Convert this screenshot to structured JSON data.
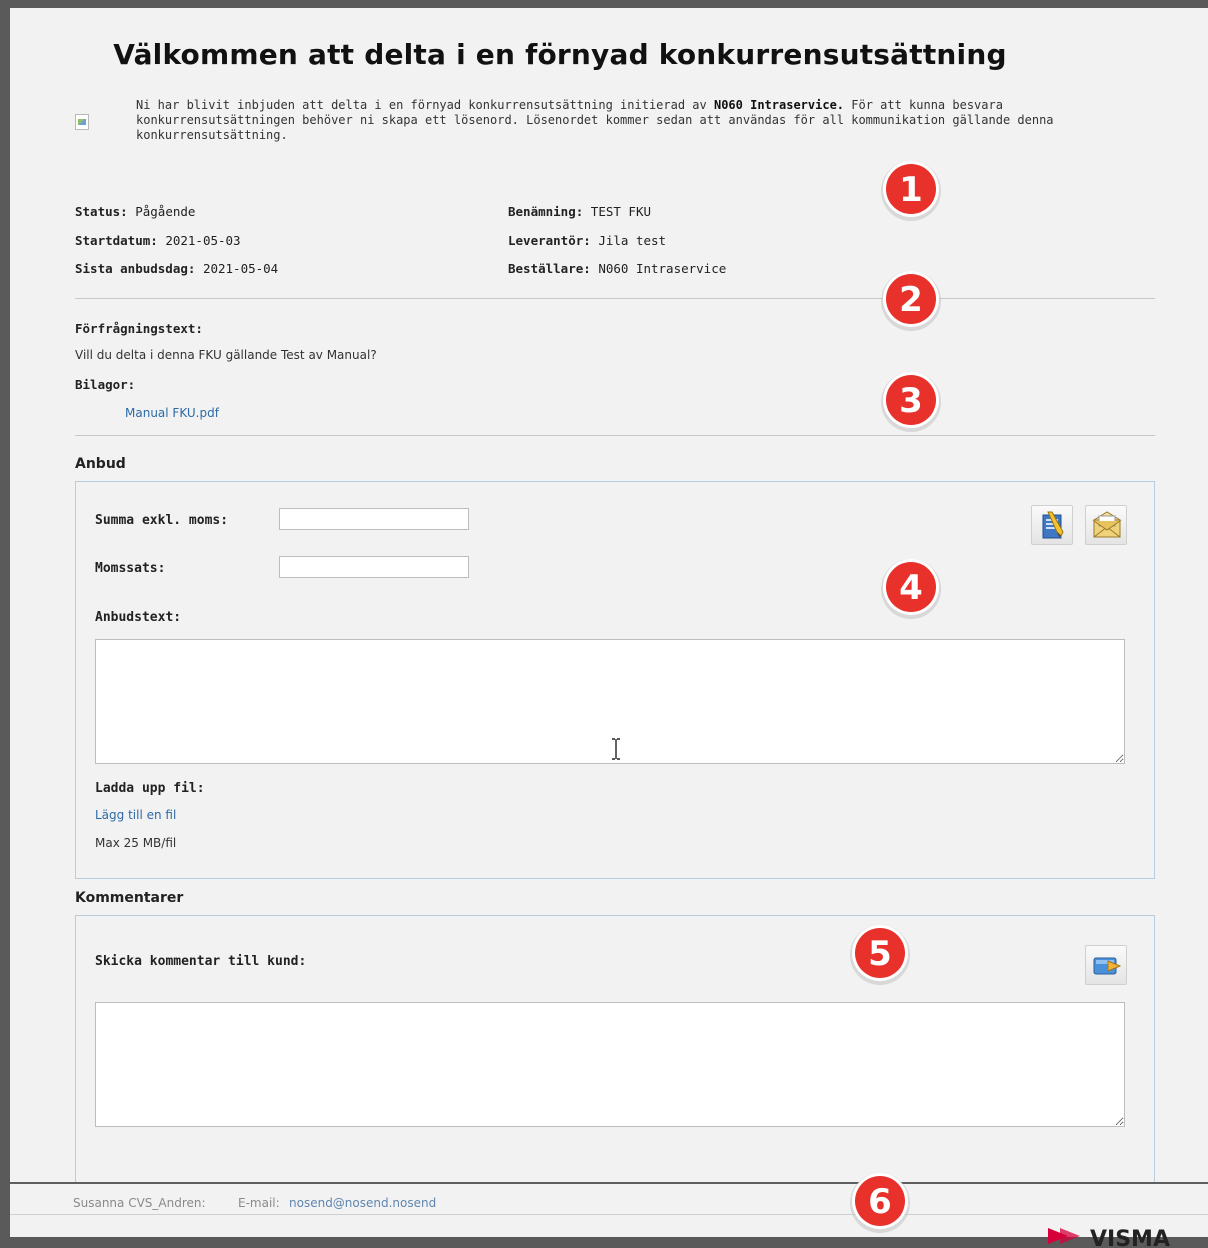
{
  "title": "Välkommen att delta i en förnyad konkurrensutsättning",
  "intro": {
    "text_before": "Ni har blivit inbjuden att delta i en förnyad konkurrensutsättning initierad av ",
    "org": "N060 Intraservice.",
    "text_after": " För att kunna besvara konkurrensutsättningen behöver ni skapa ett lösenord. Lösenordet kommer sedan att användas för all kommunikation gällande denna konkurrensutsättning."
  },
  "meta": {
    "status_label": "Status:",
    "status_value": "Pågående",
    "start_label": "Startdatum:",
    "start_value": "2021-05-03",
    "last_label": "Sista anbudsdag:",
    "last_value": "2021-05-04",
    "name_label": "Benämning:",
    "name_value": "TEST FKU",
    "supplier_label": "Leverantör:",
    "supplier_value": "Jila test",
    "orderer_label": "Beställare:",
    "orderer_value": "N060 Intraservice"
  },
  "request": {
    "label": "Förfrågningstext:",
    "text": "Vill du delta i denna FKU gällande Test av Manual?",
    "attachments_label": "Bilagor:",
    "attachment": "Manual FKU.pdf"
  },
  "bid": {
    "section_title": "Anbud",
    "sum_label": "Summa exkl. moms:",
    "sum_value": "",
    "vat_label": "Momssats:",
    "vat_value": "",
    "text_label": "Anbudstext:",
    "text_value": "",
    "upload_label": "Ladda upp fil:",
    "add_file": "Lägg till en fil",
    "max_size": "Max 25 MB/fil",
    "icons": [
      "edit-document-icon",
      "envelope-icon"
    ]
  },
  "comments": {
    "section_title": "Kommentarer",
    "send_label": "Skicka kommentar till kund:",
    "text_value": "",
    "icons": [
      "send-icon"
    ]
  },
  "footer": {
    "user": "Susanna CVS_Andren:",
    "email_label": "E-mail:",
    "email": "nosend@nosend.nosend",
    "logo_text": "VISMA"
  },
  "badges": [
    "1",
    "2",
    "3",
    "4",
    "5",
    "6"
  ],
  "colors": {
    "badge_red": "#e8312a",
    "link_blue": "#2c6aa8",
    "box_border": "#b8cde0",
    "logo_red": "#d6003b"
  }
}
